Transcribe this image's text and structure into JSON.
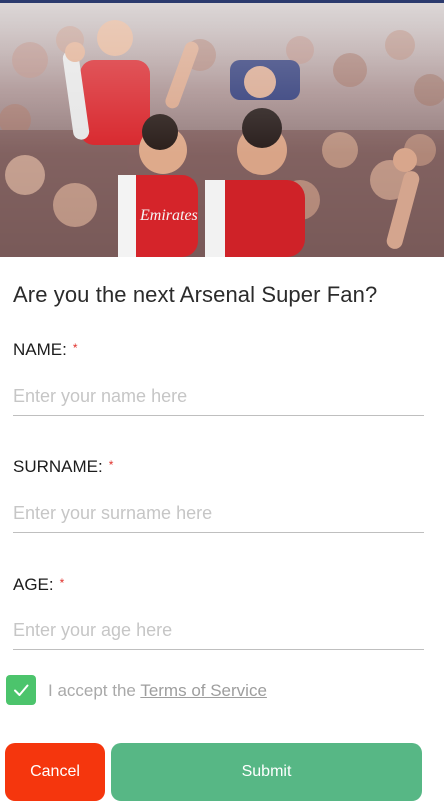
{
  "hero": {
    "image": "crowd-of-arsenal-fans-cheering",
    "kit_text": "Emirates"
  },
  "form": {
    "title": "Are you the next Arsenal Super Fan?",
    "required_mark": "*",
    "fields": [
      {
        "label": "NAME:",
        "placeholder": "Enter your name here",
        "value": ""
      },
      {
        "label": "SURNAME:",
        "placeholder": "Enter your surname here",
        "value": ""
      },
      {
        "label": "AGE:",
        "placeholder": "Enter your age here",
        "value": ""
      }
    ],
    "terms": {
      "checked": true,
      "prefix": "I accept the ",
      "link_label": "Terms of Service"
    }
  },
  "actions": {
    "cancel_label": "Cancel",
    "submit_label": "Submit"
  },
  "colors": {
    "cancel": "#f5360d",
    "submit": "#57b785",
    "checkbox": "#4cc46c",
    "required": "#e0302b"
  }
}
